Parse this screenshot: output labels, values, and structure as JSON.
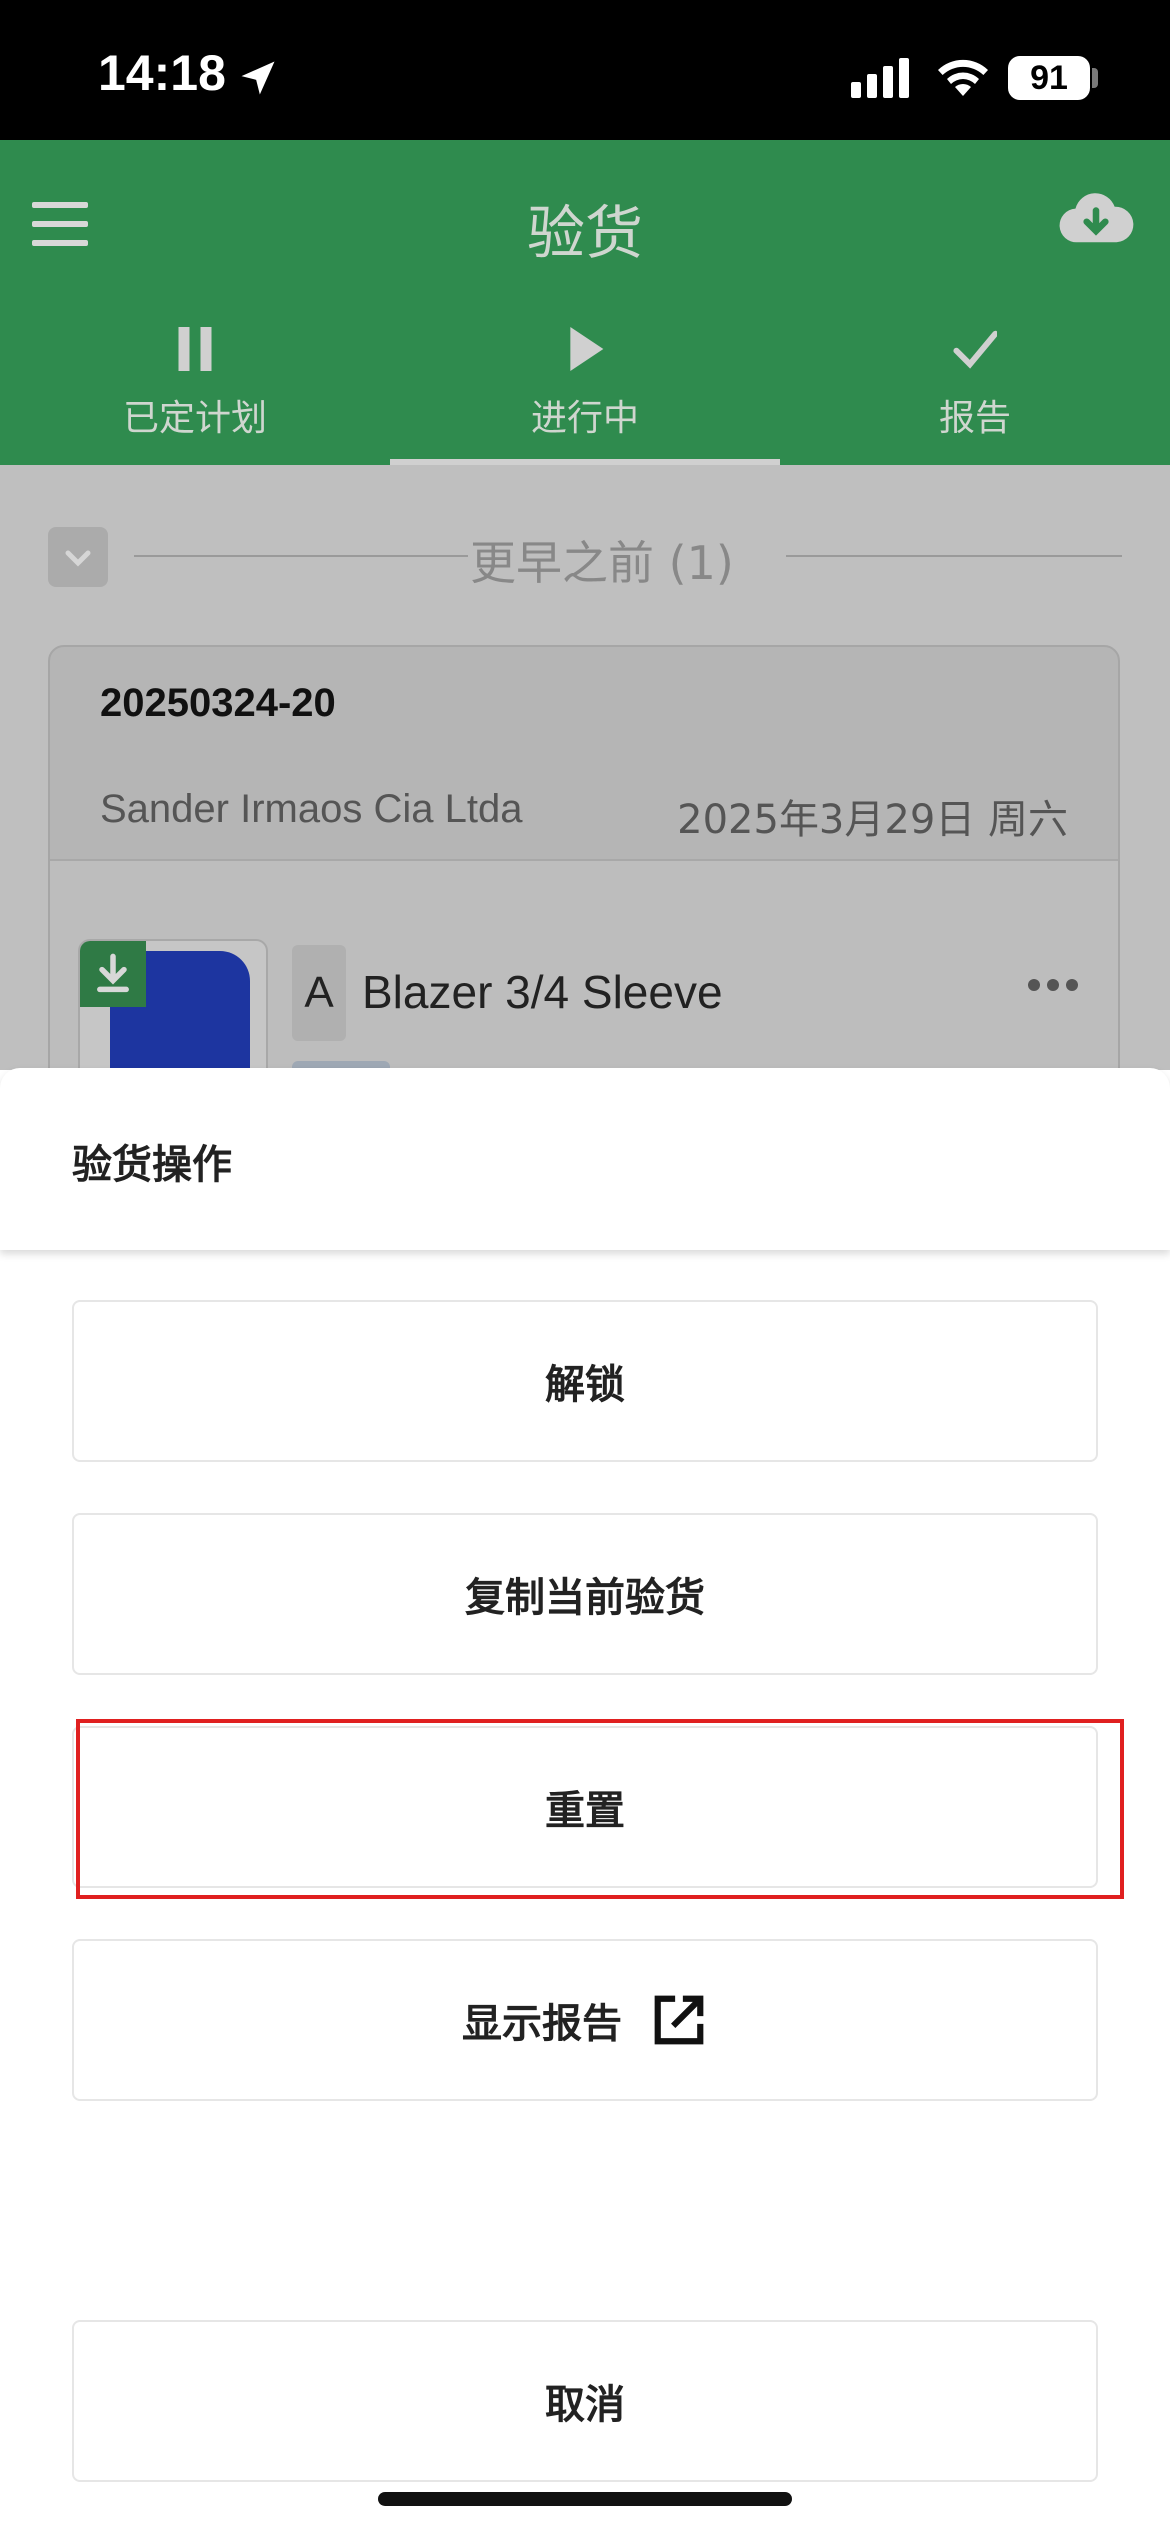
{
  "status_bar": {
    "time": "14:18",
    "battery": "91"
  },
  "header": {
    "title": "验货",
    "icons": [
      "menu-icon",
      "cloud-download-icon"
    ],
    "tabs": [
      {
        "label": "已定计划",
        "icon": "pause-icon",
        "active": false
      },
      {
        "label": "进行中",
        "icon": "play-icon",
        "active": true
      },
      {
        "label": "报告",
        "icon": "check-icon",
        "active": false
      }
    ]
  },
  "list": {
    "section_title": "更早之前 (1)",
    "card": {
      "id": "20250324-20",
      "supplier": "Sander Irmaos Cia Ltda",
      "date": "2025年3月29日 周六",
      "product_prefix": "A",
      "product_name": "Blazer 3/4 Sleeve"
    }
  },
  "sheet": {
    "title": "验货操作",
    "buttons": {
      "unlock": "解锁",
      "copy": "复制当前验货",
      "reset": "重置",
      "show_report": "显示报告",
      "cancel": "取消"
    }
  },
  "colors": {
    "brand_green": "#2f8b4e",
    "highlight_red": "#e02020"
  }
}
